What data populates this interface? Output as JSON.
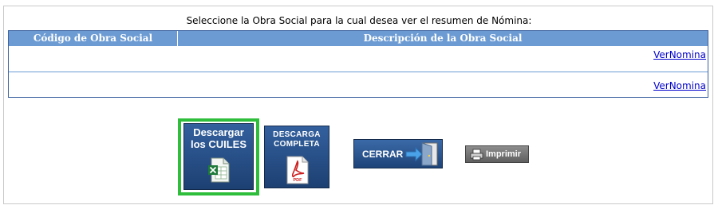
{
  "prompt_text": "Seleccione la Obra Social para la cual desea ver el resumen de Nómina:",
  "table": {
    "columns": [
      "Código de Obra Social",
      "Descripción de la Obra Social"
    ],
    "rows": [
      {
        "code": "",
        "description": "",
        "link": "VerNomina"
      },
      {
        "code": "",
        "description": "",
        "link": "VerNomina"
      }
    ]
  },
  "buttons": {
    "cuiles_line1": "Descargar",
    "cuiles_line2": "los CUILES",
    "pdf_line1": "DESCARGA",
    "pdf_line2": "COMPLETA",
    "pdf_icon_text": "PDF",
    "cerrar": "CERRAR",
    "imprimir": "Imprimir"
  },
  "colors": {
    "header_bg": "#6c9bd3",
    "button_blue": "#1d4072",
    "selection_outline": "#2fbe3c",
    "link": "#0000cc"
  },
  "icons": [
    "excel-icon",
    "pdf-icon",
    "exit-door-icon",
    "printer-icon"
  ]
}
